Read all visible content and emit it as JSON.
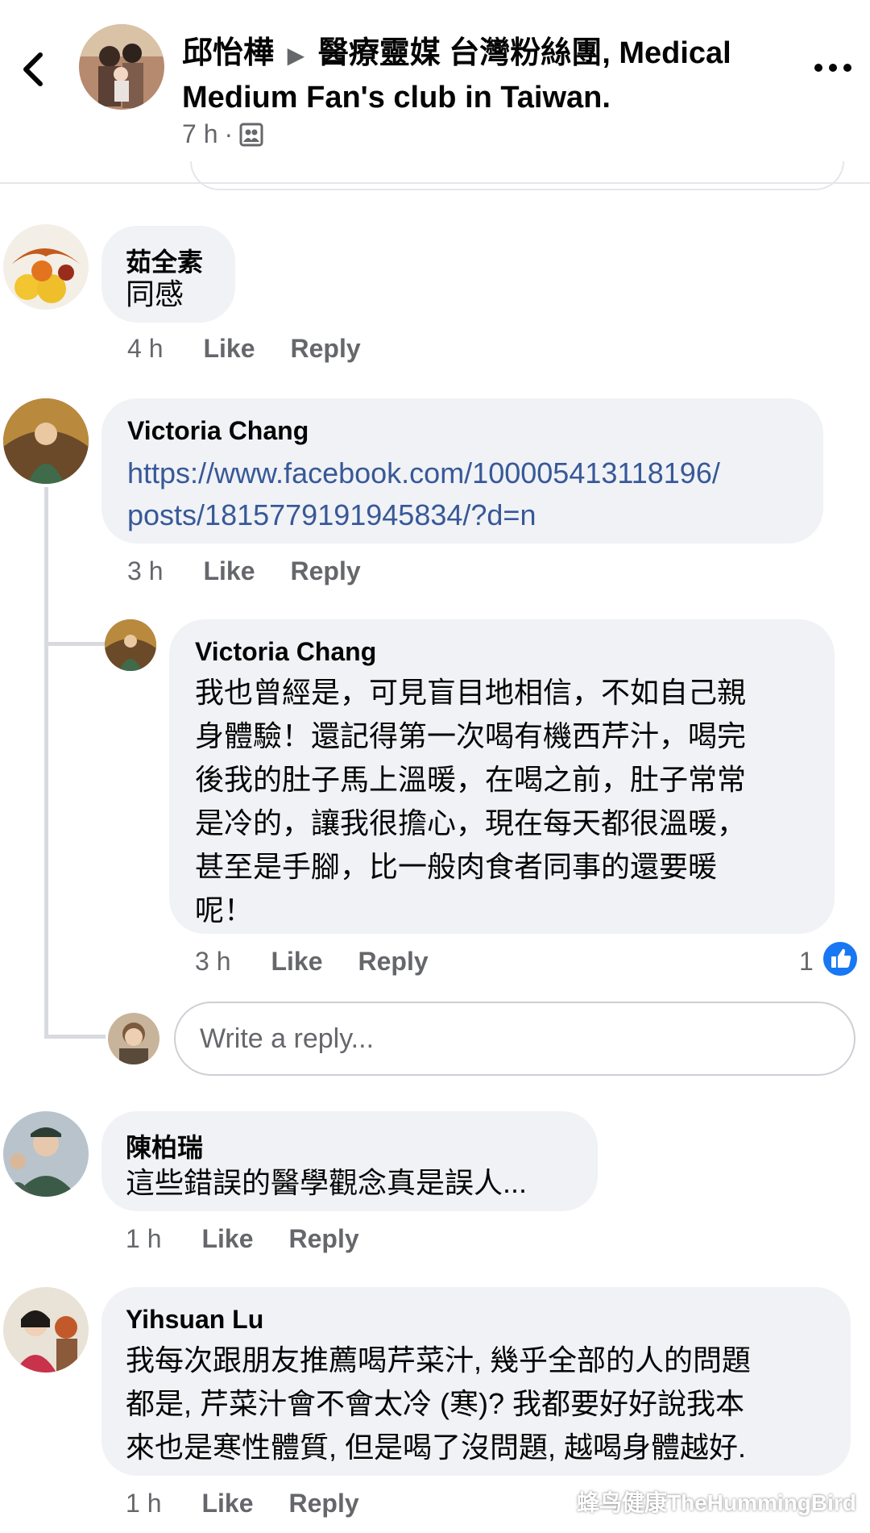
{
  "header": {
    "author": "邱怡樺",
    "arrow": "▶",
    "group": "醫療靈媒 台灣粉絲團, Medical Medium Fan's club in Taiwan.",
    "time": "7 h",
    "dot": "·",
    "back_icon": "chevron-left-icon",
    "more_icon": "more-horizontal-icon",
    "audience_icon": "group-members-icon"
  },
  "comments": [
    {
      "author": "茹全素",
      "text": "同感",
      "time": "4 h",
      "like": "Like",
      "reply": "Reply"
    },
    {
      "author": "Victoria Chang",
      "link_line1": "https://www.facebook.com/100005413118196/",
      "link_line2": "posts/1815779191945834/?d=n",
      "time": "3 h",
      "like": "Like",
      "reply": "Reply"
    },
    {
      "author": "Victoria Chang",
      "lines": [
        "我也曾經是，可見盲目地相信，不如自己親",
        "身體驗！還記得第一次喝有機西芹汁，喝完",
        "後我的肚子馬上溫暖，在喝之前，肚子常常",
        "是冷的，讓我很擔心，現在每天都很溫暖，",
        "甚至是手腳，比一般肉食者同事的還要暖",
        "呢！"
      ],
      "time": "3 h",
      "like": "Like",
      "reply": "Reply",
      "reaction_count": "1",
      "reaction_icon": "thumbs-up-icon"
    },
    {
      "author": "陳柏瑞",
      "text": "這些錯誤的醫學觀念真是誤人...",
      "time": "1 h",
      "like": "Like",
      "reply": "Reply"
    },
    {
      "author": "Yihsuan Lu",
      "lines": [
        "我每次跟朋友推薦喝芹菜汁, 幾乎全部的人的問題",
        "都是, 芹菜汁會不會太冷 (寒)? 我都要好好說我本",
        "來也是寒性體質, 但是喝了沒問題, 越喝身體越好."
      ],
      "time": "1 h",
      "like": "Like",
      "reply": "Reply"
    }
  ],
  "reply_input": {
    "placeholder": "Write a reply..."
  },
  "watermark": {
    "text": "蜂鸟健康TheHummingBird"
  },
  "colors": {
    "link": "#385898",
    "bubble": "#f0f2f5",
    "secondary": "#65676b",
    "like_blue": "#1877f2"
  }
}
